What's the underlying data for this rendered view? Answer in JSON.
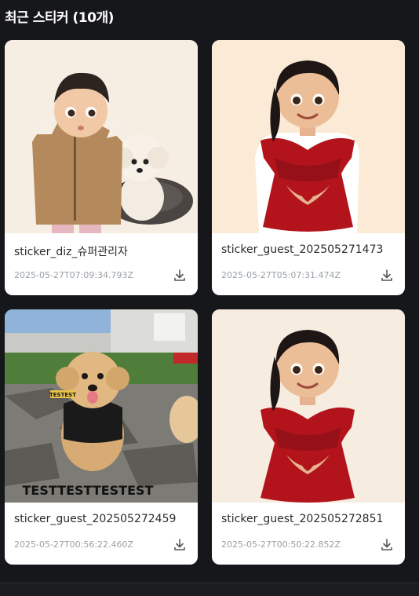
{
  "header": {
    "title": "최근 스티커 (10개)"
  },
  "stickers": [
    {
      "name": "sticker_diz_슈퍼관리자",
      "date": "2025-05-27T07:09:34.793Z",
      "icon": "download-icon"
    },
    {
      "name": "sticker_guest_202505271473",
      "date": "2025-05-27T05:07:31.474Z",
      "icon": "download-icon"
    },
    {
      "name": "sticker_guest_202505272459",
      "date": "2025-05-27T00:56:22.460Z",
      "icon": "download-icon"
    },
    {
      "name": "sticker_guest_202505272851",
      "date": "2025-05-27T00:50:22.852Z",
      "icon": "download-icon"
    }
  ],
  "watermark": "TESTTESTTESTEST",
  "tag_text": "TESTEST",
  "colors": {
    "background": "#16171b",
    "card": "#ffffff",
    "dress": "#b3141c"
  }
}
